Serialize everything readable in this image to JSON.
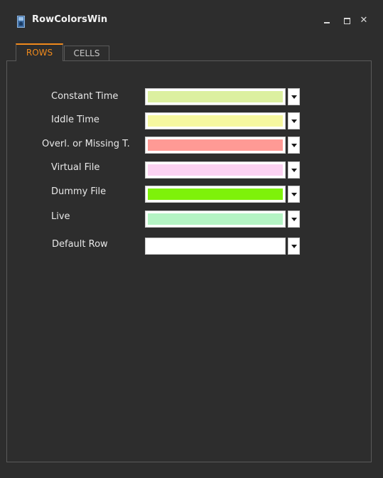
{
  "window": {
    "title": "RowColorsWin",
    "controls": {
      "minimize": "minimize",
      "maximize": "maximize",
      "close": "✕"
    }
  },
  "tabs": [
    {
      "label": "ROWS",
      "active": true
    },
    {
      "label": "CELLS",
      "active": false
    }
  ],
  "rows": [
    {
      "label": "Constant Time",
      "color": "#dcf0a0"
    },
    {
      "label": "Iddle Time",
      "color": "#f6f8a0"
    },
    {
      "label": "Overl. or Missing T.",
      "color": "#ff9a95"
    },
    {
      "label": "Virtual File",
      "color": "#fcd2f2"
    },
    {
      "label": "Dummy File",
      "color": "#7ef20a"
    },
    {
      "label": "Live",
      "color": "#b4f4c4"
    },
    {
      "label": "Default Row",
      "color": "#ffffff"
    }
  ],
  "colors": {
    "background": "#2d2d2d",
    "accent": "#f08a1c",
    "border": "#5a5a5a"
  },
  "icons": {
    "app": "window-app-icon",
    "dropdown": "chevron-down-icon"
  }
}
